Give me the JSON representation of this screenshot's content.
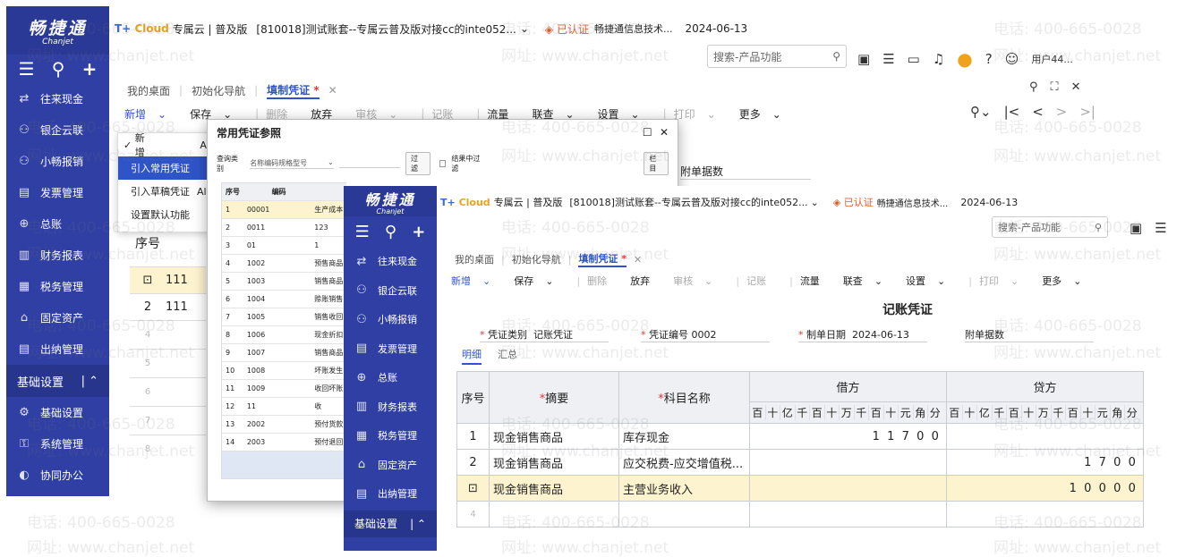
{
  "sidebar_back": {
    "logo": "畅捷通",
    "logo_sub": "Chanjet",
    "tools": [
      "☰",
      "⚲",
      "+"
    ],
    "items": [
      "往来现金",
      "银企云联",
      "小畅报销",
      "发票管理",
      "总账",
      "财务报表",
      "税务管理",
      "固定资产",
      "出纳管理"
    ],
    "group": "基础设置",
    "sub_items": [
      "基础设置",
      "系统管理",
      "协同办公"
    ]
  },
  "topbar_back": {
    "cloud": "Cloud",
    "cloud_prefix": "T+",
    "edition": "专属云 | 普及版",
    "account": "[810018]测试账套--专属云普及版对接cc的inte052...",
    "verified": "已认证",
    "company": "畅捷通信息技术...",
    "date": "2024-06-13",
    "search_placeholder": "搜索-产品功能",
    "user": "用户44..."
  },
  "tabs_back": [
    "我的桌面",
    "初始化导航",
    "填制凭证"
  ],
  "toolbar_back": [
    "新增",
    "保存",
    "删除",
    "放弃",
    "审核",
    "记账",
    "流量",
    "联查",
    "设置",
    "打印",
    "更多"
  ],
  "dropdown": {
    "check": "新增",
    "items": [
      "引入常用凭证",
      "引入草稿凭证",
      "设置默认功能"
    ],
    "trail": [
      "Al",
      "Al"
    ]
  },
  "back_body": {
    "fujian": "附单据数",
    "xuhao": "序号",
    "rows": [
      {
        "no": "⊡",
        "v": "111"
      },
      {
        "no": "2",
        "v": "111"
      }
    ],
    "empty": [
      "4",
      "5",
      "6",
      "7",
      "8"
    ]
  },
  "modal": {
    "title": "常用凭证参照",
    "query_label": "查询类别",
    "query_value": "名称编码规格型号",
    "filter_btn": "过滤",
    "check_label": "结果中过滤",
    "col_btn": "栏目",
    "headers": [
      "序号",
      "编码",
      ""
    ],
    "rows": [
      [
        "1",
        "00001",
        "生产成本"
      ],
      [
        "2",
        "0011",
        "123"
      ],
      [
        "3",
        "01",
        "1"
      ],
      [
        "4",
        "1002",
        "预售商品"
      ],
      [
        "5",
        "1003",
        "销售商品"
      ],
      [
        "6",
        "1004",
        "赊账销售"
      ],
      [
        "7",
        "1005",
        "销售收回"
      ],
      [
        "8",
        "1006",
        "现金折扣"
      ],
      [
        "9",
        "1007",
        "销售商品"
      ],
      [
        "10",
        "1008",
        "坏账发生"
      ],
      [
        "11",
        "1009",
        "收回坏账"
      ],
      [
        "12",
        "11",
        "收"
      ],
      [
        "13",
        "2002",
        "预付货款"
      ],
      [
        "14",
        "2003",
        "预付退回"
      ]
    ]
  },
  "front": {
    "sidebar_items": [
      "往来现金",
      "银企云联",
      "小畅报销",
      "发票管理",
      "总账",
      "财务报表",
      "税务管理",
      "固定资产",
      "出纳管理"
    ],
    "sidebar_group": "基础设置",
    "voucher_title": "记账凭证",
    "fields": {
      "type_label": "凭证类别",
      "type_value": "记账凭证",
      "no_label": "凭证编号",
      "no_value": "0002",
      "date_label": "制单日期",
      "date_value": "2024-06-13",
      "attach_label": "附单据数"
    },
    "subtabs": [
      "明细",
      "汇总"
    ],
    "table": {
      "h_no": "序号",
      "h_summary": "摘要",
      "h_subject": "科目名称",
      "h_debit": "借方",
      "h_credit": "贷方",
      "digits": [
        "百",
        "十",
        "亿",
        "千",
        "百",
        "十",
        "万",
        "千",
        "百",
        "十",
        "元",
        "角",
        "分"
      ],
      "rows": [
        {
          "no": "1",
          "summary": "现金销售商品",
          "subject": "库存现金",
          "debit": "11700",
          "credit": ""
        },
        {
          "no": "2",
          "summary": "现金销售商品",
          "subject": "应交税费-应交增值税...",
          "debit": "",
          "credit": "1700"
        },
        {
          "no": "⊡",
          "summary": "现金销售商品",
          "subject": "主营业务收入",
          "debit": "",
          "credit": "10000"
        }
      ],
      "empty_no": "4"
    }
  },
  "watermark": {
    "phone": "电话: 400-665-0028",
    "web": "网址: www.chanjet.net"
  }
}
